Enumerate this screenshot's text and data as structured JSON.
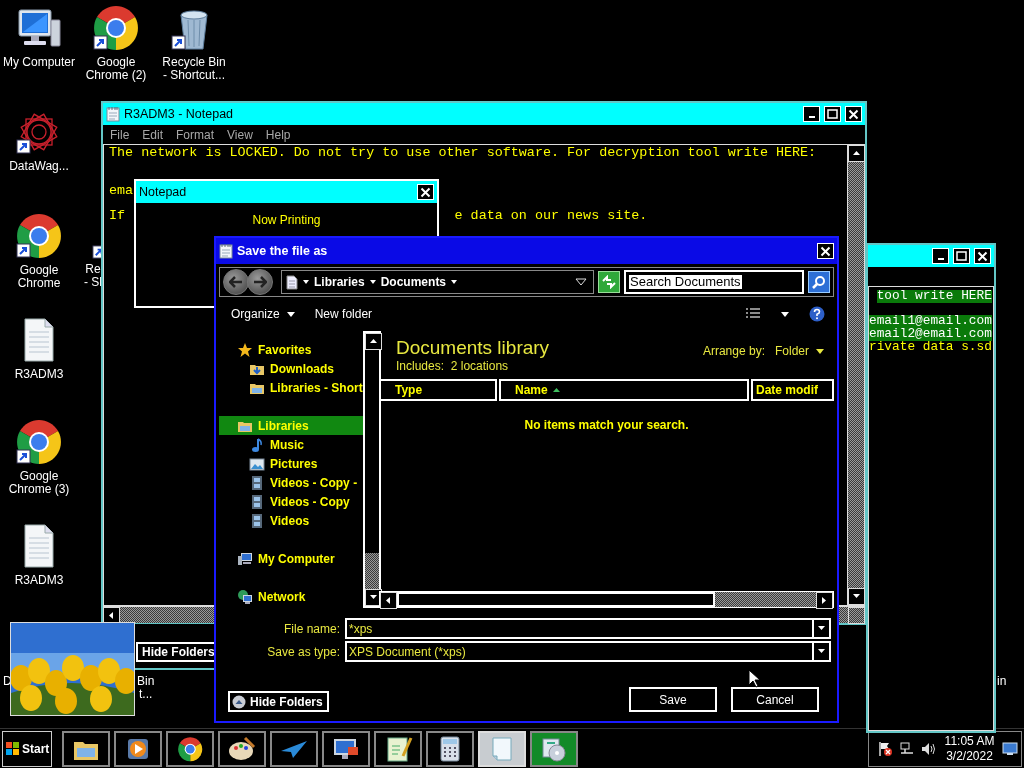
{
  "desktop_icons": [
    {
      "kind": "computer",
      "lines": [
        "My Computer"
      ],
      "shortcut": false
    },
    {
      "kind": "chrome",
      "lines": [
        "Google",
        "Chrome (2)"
      ],
      "shortcut": true
    },
    {
      "kind": "recycle",
      "lines": [
        "Recycle Bin",
        "- Shortcut..."
      ],
      "shortcut": true
    },
    {
      "kind": "datawag",
      "lines": [
        "DataWag..."
      ],
      "shortcut": true
    },
    {
      "kind": "chrome",
      "lines": [
        "Google",
        "Chrome"
      ],
      "shortcut": true
    },
    {
      "kind": "partial",
      "lines": [
        "Re",
        "- Sl"
      ],
      "shortcut": true
    },
    {
      "kind": "document",
      "lines": [
        "R3ADM3"
      ],
      "shortcut": false
    },
    {
      "kind": "chrome",
      "lines": [
        "Google",
        "Chrome (3)"
      ],
      "shortcut": true
    },
    {
      "kind": "document",
      "lines": [
        "R3ADM3"
      ],
      "shortcut": false
    },
    {
      "kind": "label",
      "lines": [
        "D"
      ]
    },
    {
      "kind": "label",
      "lines": [
        "Bin",
        "t..."
      ]
    },
    {
      "kind": "label",
      "lines": [
        "in"
      ]
    }
  ],
  "notepad_right": {
    "paragraphs": [
      [
        {
          "text": "tool write HERE",
          "selected": true
        }
      ],
      [
        {
          "text": "email1@email.com",
          "selected": true
        },
        {
          "text": "email2@email.com",
          "selected": true
        },
        {
          "text": "rivate data s.sd",
          "selected": false
        }
      ]
    ]
  },
  "notepad_main": {
    "title": "R3ADM3 - Notepad",
    "menu": [
      "File",
      "Edit",
      "Format",
      "View",
      "Help"
    ],
    "paragraphs": [
      [
        [
          "The network is LOCKED. Do not try to use other software. For decryption tool write HERE:"
        ]
      ],
      [
        [
          "ema"
        ]
      ],
      [
        [
          "If",
          "e data on our news site."
        ]
      ]
    ]
  },
  "dialog_behind": {
    "button": "Hide Folders"
  },
  "notepad_popup": {
    "title": "Notepad",
    "lines": [
      "Now Printing"
    ]
  },
  "save_dialog": {
    "title": "Save the file as",
    "breadcrumb": [
      "Libraries",
      "Documents"
    ],
    "search": {
      "value": "Search Documents"
    },
    "toolbar": [
      {
        "label": "Organize",
        "menu": true
      },
      {
        "label": "New folder",
        "menu": false
      }
    ],
    "nav": [
      {
        "label": "Favorites",
        "kind": "star",
        "selected": false,
        "children": [
          {
            "label": "Downloads",
            "kind": "download",
            "selected": false
          },
          {
            "label": "Libraries - Short",
            "kind": "library",
            "selected": false
          }
        ]
      },
      {
        "label": "Libraries",
        "kind": "library",
        "selected": true,
        "children": [
          {
            "label": "Music",
            "kind": "music",
            "selected": false
          },
          {
            "label": "Pictures",
            "kind": "pictures",
            "selected": false
          },
          {
            "label": "Videos - Copy -",
            "kind": "video",
            "selected": false
          },
          {
            "label": "Videos - Copy",
            "kind": "video",
            "selected": false
          },
          {
            "label": "Videos",
            "kind": "video",
            "selected": false
          }
        ]
      },
      {
        "label": "My Computer",
        "kind": "computer",
        "selected": false
      },
      {
        "label": "Network",
        "kind": "network",
        "selected": false
      }
    ],
    "library": {
      "title": "Documents library",
      "includes_label": "Includes:",
      "includes": "2 locations",
      "arrange_label": "Arrange by:",
      "arrange": "Folder"
    },
    "columns": [
      {
        "label": "Type",
        "sorted": false
      },
      {
        "label": "Name",
        "sorted": true
      },
      {
        "label": "Date modif",
        "sorted": false
      }
    ],
    "empty_message": "No items match your search.",
    "file_name": {
      "label": "File name:",
      "value": "*xps"
    },
    "save_type": {
      "label": "Save as type:",
      "value": "XPS Document (*xps)"
    },
    "hide_folders": "Hide Folders",
    "buttons": [
      "Save",
      "Cancel"
    ]
  },
  "taskbar": {
    "start": "Start",
    "apps": [
      {
        "kind": "explorer",
        "selected": false,
        "flashing": false
      },
      {
        "kind": "media",
        "selected": false,
        "flashing": false
      },
      {
        "kind": "chrome",
        "selected": false,
        "flashing": false
      },
      {
        "kind": "paint",
        "selected": false,
        "flashing": false
      },
      {
        "kind": "plane",
        "selected": false,
        "flashing": false
      },
      {
        "kind": "remote",
        "selected": false,
        "flashing": false
      },
      {
        "kind": "notepadpp",
        "selected": false,
        "flashing": false
      },
      {
        "kind": "calculator",
        "selected": false,
        "flashing": false
      },
      {
        "kind": "notepad",
        "selected": true,
        "flashing": false
      },
      {
        "kind": "installer",
        "selected": false,
        "flashing": true
      }
    ],
    "time": "11:05 AM",
    "date": "3/2/2022"
  }
}
